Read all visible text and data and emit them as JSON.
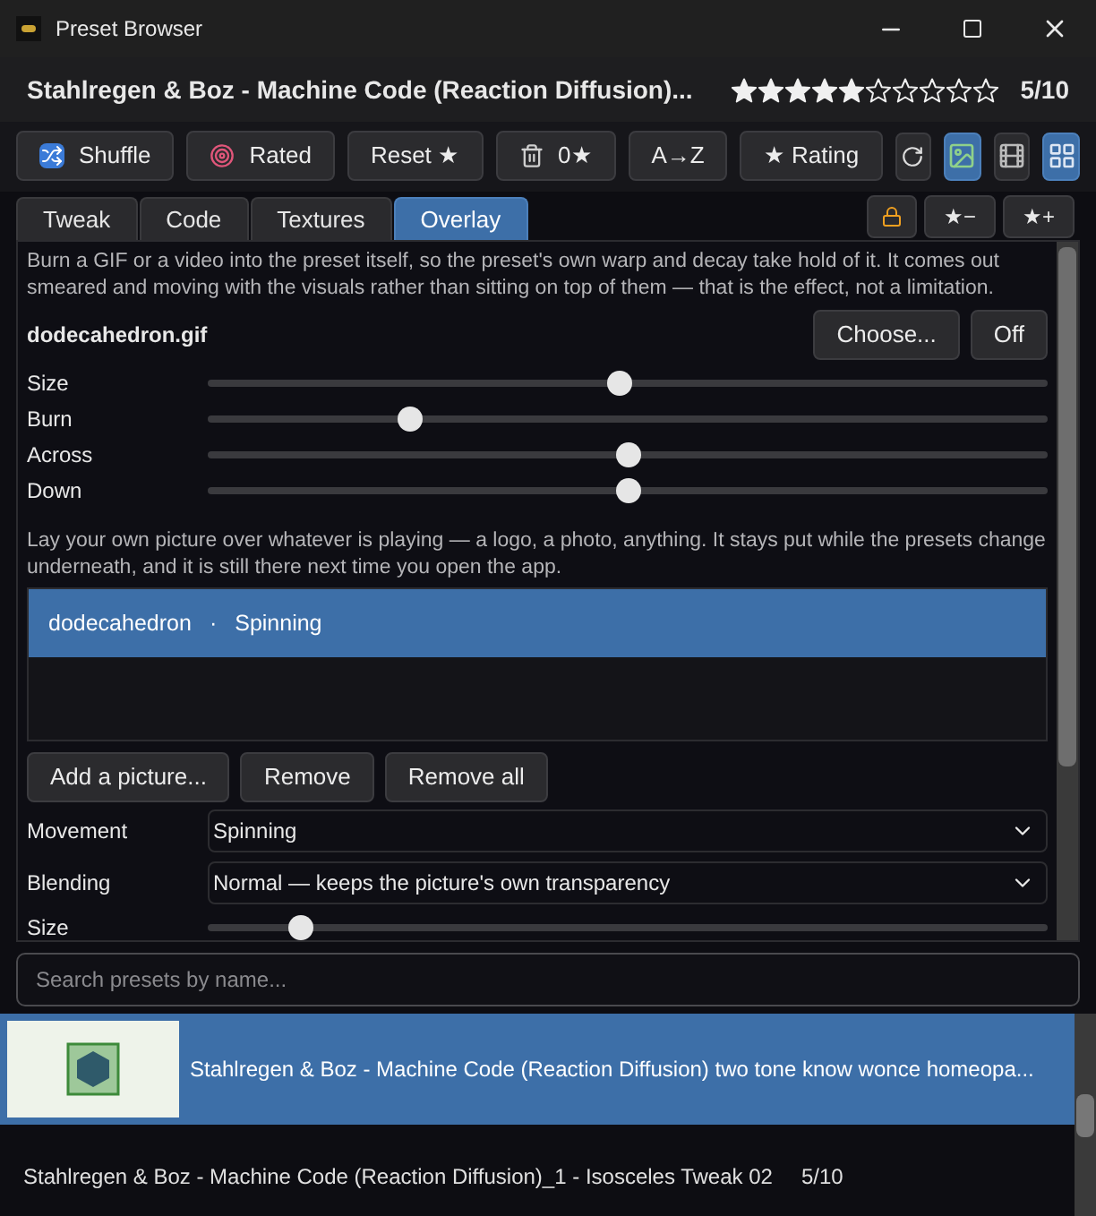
{
  "window": {
    "title": "Preset Browser"
  },
  "preset": {
    "title": "Stahlregen & Boz - Machine Code (Reaction Diffusion)...",
    "stars": 5,
    "score": "5/10"
  },
  "toolbar": [
    {
      "kind": "text",
      "label": "Shuffle"
    },
    {
      "kind": "text",
      "label": "Rated"
    },
    {
      "kind": "text",
      "label": "Reset ★"
    },
    {
      "kind": "text",
      "label": "0★"
    },
    {
      "kind": "text",
      "label": "A→Z"
    },
    {
      "kind": "text",
      "label": "★ Rating"
    },
    {
      "kind": "icon",
      "selected": false
    },
    {
      "kind": "icon",
      "selected": true
    },
    {
      "kind": "icon",
      "selected": false
    },
    {
      "kind": "icon",
      "selected": true
    }
  ],
  "tabs": [
    {
      "label": "Tweak",
      "selected": false
    },
    {
      "label": "Code",
      "selected": false
    },
    {
      "label": "Textures",
      "selected": false
    },
    {
      "label": "Overlay",
      "selected": true
    }
  ],
  "tab_actions": [
    "★−",
    "★+"
  ],
  "burn": {
    "description": "Burn a GIF or a video into the preset itself, so the preset's own warp and decay take hold of it. It comes out smeared and moving with the visuals rather than sitting on top of them — that is the effect, not a limitation.",
    "file": "dodecahedron.gif",
    "buttons": [
      "Choose...",
      "Off"
    ],
    "sliders": [
      {
        "label": "Size",
        "level": 0.49
      },
      {
        "label": "Burn",
        "level": 0.24
      },
      {
        "label": "Across",
        "level": 0.5
      },
      {
        "label": "Down",
        "level": 0.5
      }
    ]
  },
  "overlay": {
    "description": "Lay your own picture over whatever is playing — a logo, a photo, anything. It stays put while the presets change underneath, and it is still there next time you open the app.",
    "items": [
      {
        "name": "dodecahedron",
        "separator": "·",
        "motion": "Spinning",
        "selected": true
      }
    ],
    "buttons": [
      "Add a picture...",
      "Remove",
      "Remove all"
    ],
    "dropdowns": [
      {
        "label": "Movement",
        "value": "Spinning"
      },
      {
        "label": "Blending",
        "value": "Normal — keeps the picture's own transparency"
      }
    ],
    "size": {
      "label": "Size",
      "level": 0.11
    }
  },
  "search": {
    "placeholder": "Search presets by name..."
  },
  "presets": [
    {
      "title": "Stahlregen & Boz - Machine Code (Reaction Diffusion) two tone know wonce homeopa...",
      "selected": true
    },
    {
      "title": "Stahlregen & Boz - Machine Code (Reaction Diffusion)_1 - Isosceles Tweak 02",
      "score": "5/10",
      "selected": false
    }
  ]
}
